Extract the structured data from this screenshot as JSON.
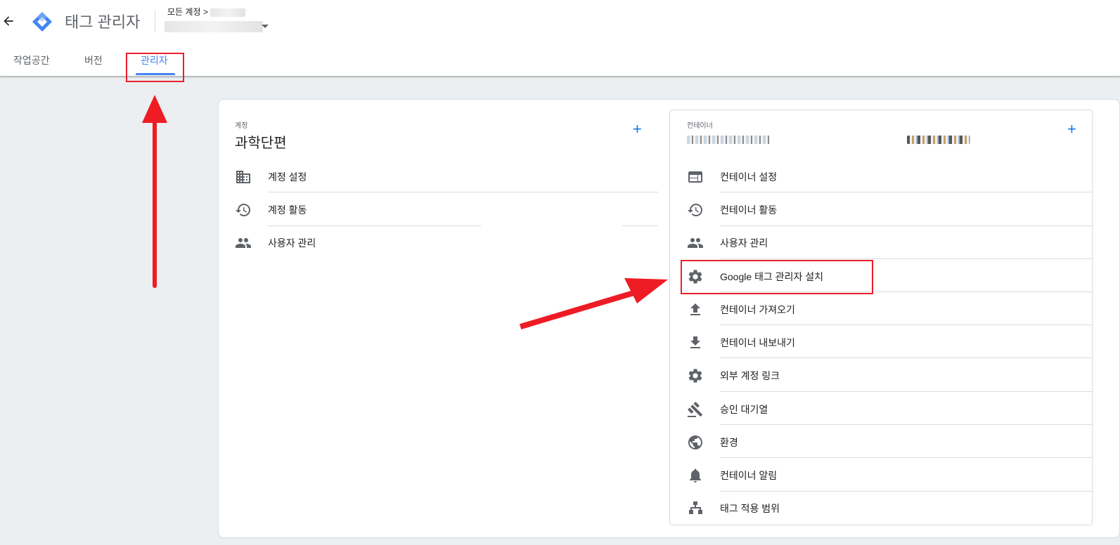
{
  "header": {
    "app_title": "태그 관리자",
    "breadcrumb": "모든 계정 >"
  },
  "tabs": [
    {
      "label": "작업공간"
    },
    {
      "label": "버전"
    },
    {
      "label": "관리자"
    }
  ],
  "account": {
    "section_label": "계정",
    "name": "과학단편",
    "items": [
      {
        "label": "계정 설정",
        "icon": "building-icon"
      },
      {
        "label": "계정 활동",
        "icon": "history-icon"
      },
      {
        "label": "사용자 관리",
        "icon": "people-icon"
      }
    ]
  },
  "container": {
    "section_label": "컨테이너",
    "items": [
      {
        "label": "컨테이너 설정",
        "icon": "web-icon"
      },
      {
        "label": "컨테이너 활동",
        "icon": "history-icon"
      },
      {
        "label": "사용자 관리",
        "icon": "people-icon"
      },
      {
        "label": "Google 태그 관리자 설치",
        "icon": "gear-icon"
      },
      {
        "label": "컨테이너 가져오기",
        "icon": "upload-icon"
      },
      {
        "label": "컨테이너 내보내기",
        "icon": "download-icon"
      },
      {
        "label": "외부 계정 링크",
        "icon": "gear-icon"
      },
      {
        "label": "승인 대기열",
        "icon": "gavel-icon"
      },
      {
        "label": "환경",
        "icon": "globe-icon"
      },
      {
        "label": "컨테이너 알림",
        "icon": "bell-icon"
      },
      {
        "label": "태그 적용 범위",
        "icon": "sitemap-icon"
      }
    ]
  },
  "colors": {
    "accent": "#4285f4",
    "highlight": "#e8202b"
  }
}
